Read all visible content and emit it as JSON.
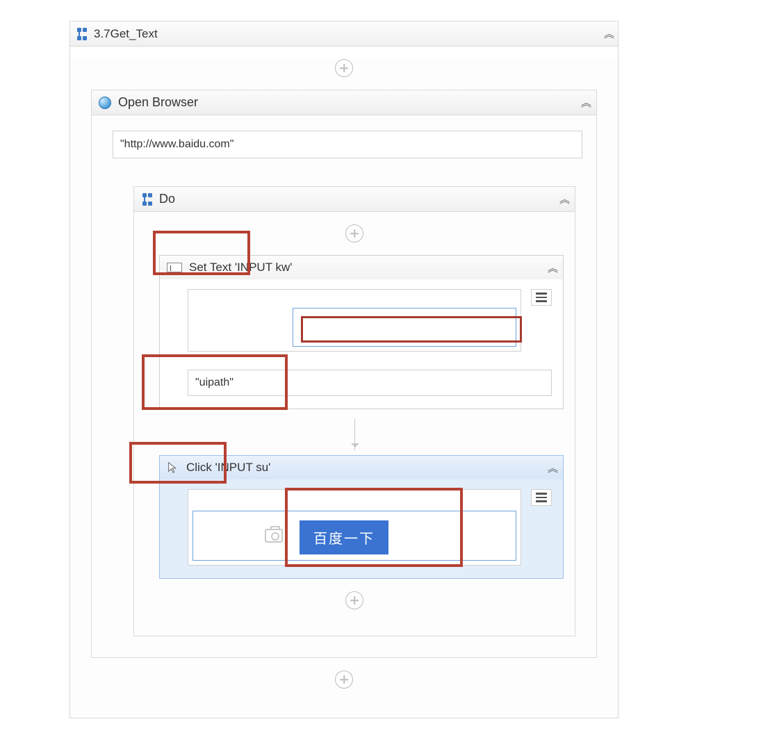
{
  "sequence": {
    "title": "3.7Get_Text"
  },
  "openBrowser": {
    "title": "Open Browser",
    "url": "\"http://www.baidu.com\""
  },
  "do": {
    "title": "Do"
  },
  "setText": {
    "title": "Set Text 'INPUT   kw'",
    "value": "\"uipath\""
  },
  "click": {
    "title": "Click 'INPUT   su'",
    "buttonLabel": "百度一下"
  }
}
